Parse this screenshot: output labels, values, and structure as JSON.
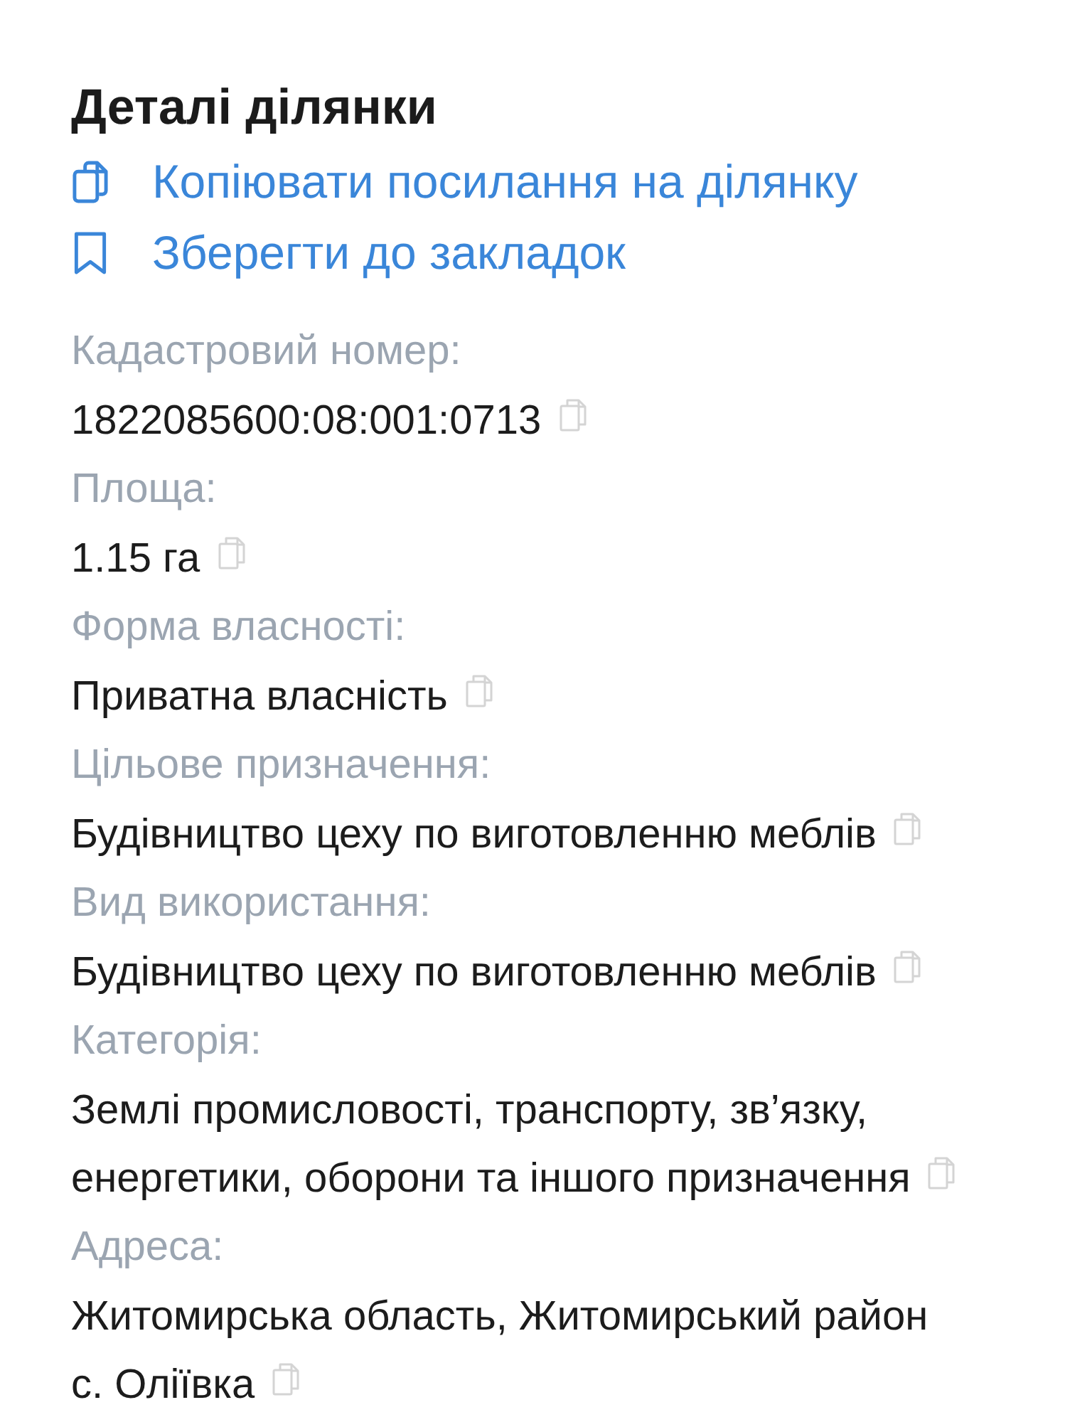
{
  "title": "Деталі ділянки",
  "actions": [
    {
      "kind": "copy",
      "label": "Копіювати посилання на ділянку"
    },
    {
      "kind": "bookmark",
      "label": "Зберегти до закладок"
    }
  ],
  "fields": [
    {
      "label": "Кадастровий номер:",
      "lines": [
        "1822085600:08:001:0713"
      ]
    },
    {
      "label": "Площа:",
      "lines": [
        "1.15 га"
      ]
    },
    {
      "label": "Форма власності:",
      "lines": [
        "Приватна власність"
      ]
    },
    {
      "label": "Цільове призначення:",
      "lines": [
        "Будівництво цеху по виготовленню меблів"
      ]
    },
    {
      "label": "Вид використання:",
      "lines": [
        "Будівництво цеху по виготовленню меблів"
      ]
    },
    {
      "label": "Категорія:",
      "lines": [
        "Землі промисловості, транспорту, зв’язку,",
        "енергетики, оборони та іншого призначення"
      ]
    },
    {
      "label": "Адреса:",
      "lines": [
        "Житомирська область, Житомирський район",
        "с. Оліївка"
      ]
    }
  ]
}
